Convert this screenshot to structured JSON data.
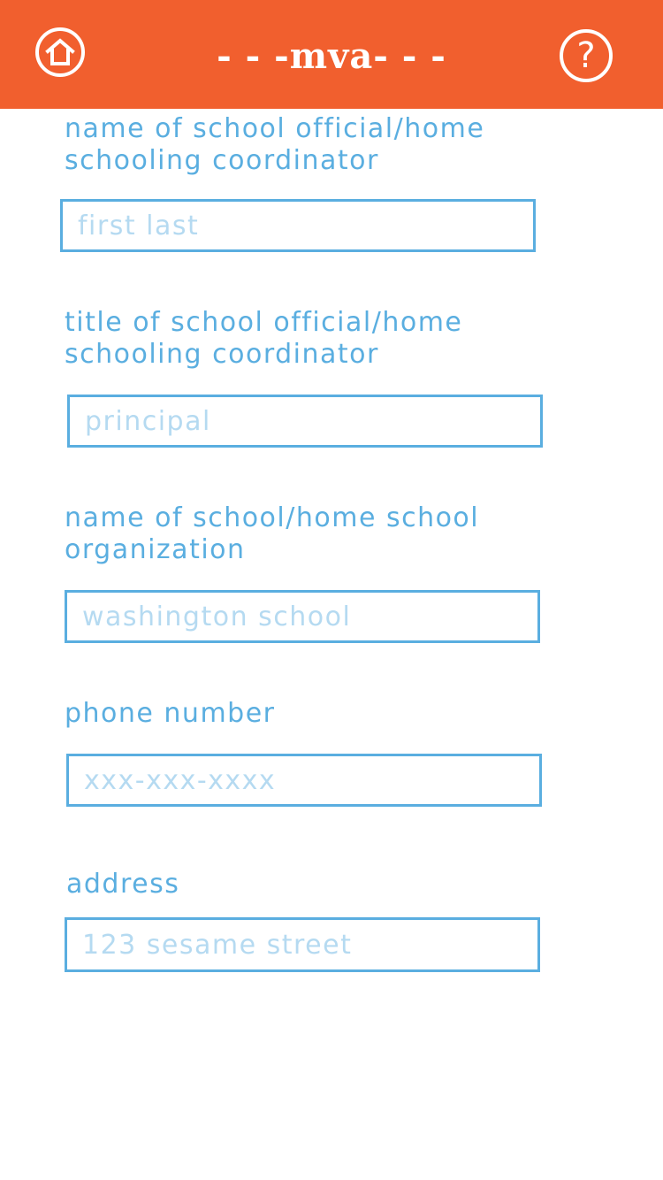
{
  "header": {
    "brand": "- - -mva- - -",
    "home_icon": "home-icon",
    "help_icon": "help-icon",
    "help_glyph": "?",
    "background_color": "#f15f2e"
  },
  "form": {
    "official_name": {
      "label": "name of school official/home schooling coordinator",
      "placeholder": "first last"
    },
    "official_title": {
      "label": "title of school official/home schooling coordinator",
      "placeholder": "principal"
    },
    "organization_name": {
      "label": "name of school/home school organization",
      "placeholder": "washington school"
    },
    "phone": {
      "label": "phone number",
      "placeholder": "xxx-xxx-xxxx"
    },
    "address": {
      "label": "address",
      "placeholder": "123 sesame street"
    }
  },
  "colors": {
    "accent": "#5aaee0",
    "placeholder": "#b5daf1"
  }
}
